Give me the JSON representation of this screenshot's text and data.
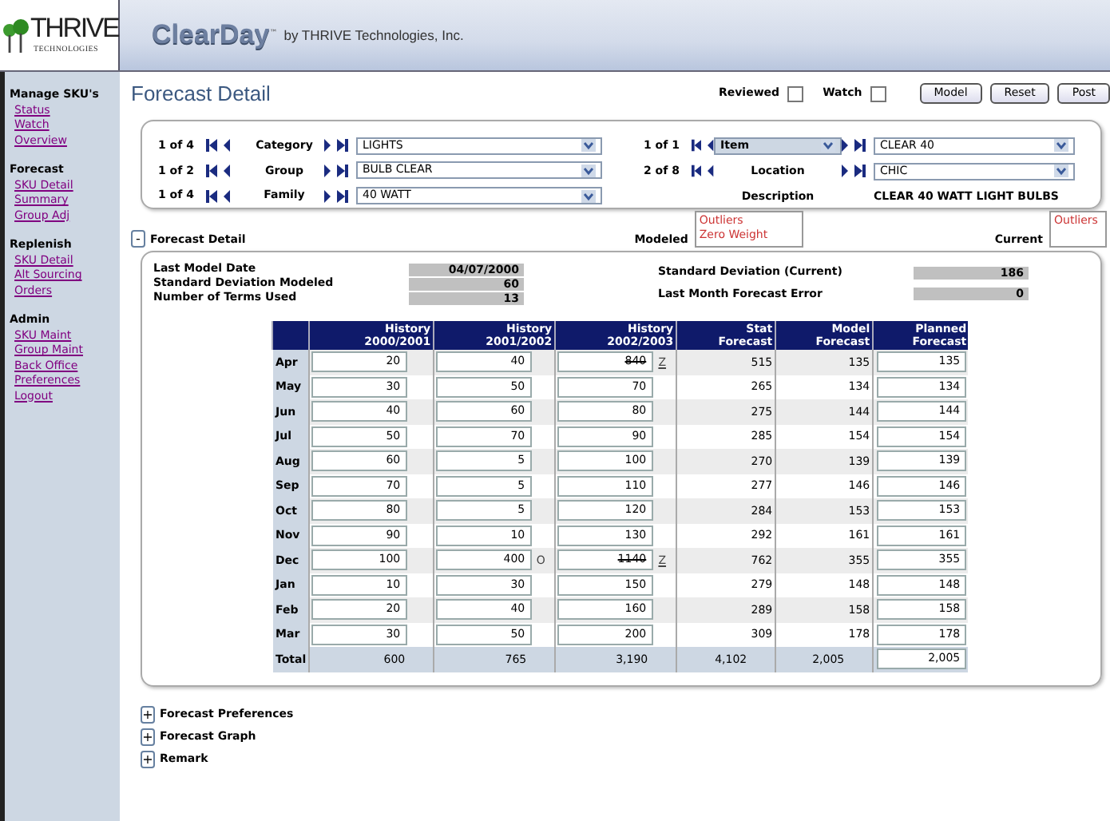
{
  "header": {
    "logo": "THRIVE",
    "logo_sub": "TECHNOLOGIES",
    "product": "ClearDay",
    "trademark": "™",
    "byline": "by THRIVE Technologies, Inc."
  },
  "sidebar": [
    {
      "title": "Manage SKU's",
      "links": [
        "Status",
        "Watch",
        "Overview"
      ]
    },
    {
      "title": "Forecast",
      "links": [
        "SKU Detail",
        "Summary",
        "Group Adj"
      ]
    },
    {
      "title": "Replenish",
      "links": [
        "SKU Detail",
        "Alt Sourcing",
        "Orders"
      ]
    },
    {
      "title": "Admin",
      "links": [
        "SKU Maint",
        "Group Maint",
        "Back Office",
        "Preferences",
        "Logout"
      ]
    }
  ],
  "title": "Forecast Detail",
  "flags": [
    {
      "label": "Reviewed",
      "checked": false
    },
    {
      "label": "Watch",
      "checked": false
    }
  ],
  "buttons": [
    "Model",
    "Reset",
    "Post"
  ],
  "selectors_left": [
    {
      "position": "1 of 4",
      "label": "Category",
      "value": "LIGHTS"
    },
    {
      "position": "1 of 2",
      "label": "Group",
      "value": "BULB CLEAR"
    },
    {
      "position": "1 of 4",
      "label": "Family",
      "value": "40 WATT"
    }
  ],
  "selectors_right": [
    {
      "position": "1 of 1",
      "label": "Item",
      "kind": "dropdown",
      "value": "CLEAR 40"
    },
    {
      "position": "2 of 8",
      "label": "Location",
      "kind": "text",
      "value": "CHIC"
    }
  ],
  "description": {
    "label": "Description",
    "value": "CLEAR 40 WATT LIGHT BULBS"
  },
  "detail_section": {
    "toggle": "-",
    "title": "Forecast Detail"
  },
  "modeled": {
    "label": "Modeled",
    "items": [
      "Outliers",
      "Zero Weight"
    ]
  },
  "current": {
    "label": "Current",
    "items": [
      "Outliers"
    ]
  },
  "stats_left": [
    {
      "label": "Last Model Date",
      "value": "04/07/2000"
    },
    {
      "label": "Standard Deviation Modeled",
      "value": "60"
    },
    {
      "label": "Number of Terms Used",
      "value": "13"
    }
  ],
  "stats_right": [
    {
      "label": "Standard Deviation (Current)",
      "value": "186"
    },
    {
      "label": "Last Month Forecast Error",
      "value": "0"
    }
  ],
  "table": {
    "columns": [
      [
        "History",
        "2000/2001"
      ],
      [
        "History",
        "2001/2002"
      ],
      [
        "History",
        "2002/2003"
      ],
      [
        "Stat",
        "Forecast"
      ],
      [
        "Model",
        "Forecast"
      ],
      [
        "Planned",
        "Forecast"
      ]
    ],
    "rows": [
      {
        "month": "Apr",
        "history": [
          {
            "value": "20"
          },
          {
            "value": "40"
          },
          {
            "value": "840",
            "struck": true,
            "marker": "Z",
            "marker_link": true
          }
        ],
        "stat": "515",
        "model": "135",
        "planned": "135"
      },
      {
        "month": "May",
        "history": [
          {
            "value": "30"
          },
          {
            "value": "50"
          },
          {
            "value": "70"
          }
        ],
        "stat": "265",
        "model": "134",
        "planned": "134"
      },
      {
        "month": "Jun",
        "history": [
          {
            "value": "40"
          },
          {
            "value": "60"
          },
          {
            "value": "80"
          }
        ],
        "stat": "275",
        "model": "144",
        "planned": "144"
      },
      {
        "month": "Jul",
        "history": [
          {
            "value": "50"
          },
          {
            "value": "70"
          },
          {
            "value": "90"
          }
        ],
        "stat": "285",
        "model": "154",
        "planned": "154"
      },
      {
        "month": "Aug",
        "history": [
          {
            "value": "60"
          },
          {
            "value": "5"
          },
          {
            "value": "100"
          }
        ],
        "stat": "270",
        "model": "139",
        "planned": "139"
      },
      {
        "month": "Sep",
        "history": [
          {
            "value": "70"
          },
          {
            "value": "5"
          },
          {
            "value": "110"
          }
        ],
        "stat": "277",
        "model": "146",
        "planned": "146"
      },
      {
        "month": "Oct",
        "history": [
          {
            "value": "80"
          },
          {
            "value": "5"
          },
          {
            "value": "120"
          }
        ],
        "stat": "284",
        "model": "153",
        "planned": "153"
      },
      {
        "month": "Nov",
        "history": [
          {
            "value": "90"
          },
          {
            "value": "10"
          },
          {
            "value": "130"
          }
        ],
        "stat": "292",
        "model": "161",
        "planned": "161"
      },
      {
        "month": "Dec",
        "history": [
          {
            "value": "100"
          },
          {
            "value": "400",
            "marker": "O",
            "marker_link": false
          },
          {
            "value": "1140",
            "struck": true,
            "marker": "Z",
            "marker_link": true
          }
        ],
        "stat": "762",
        "model": "355",
        "planned": "355"
      },
      {
        "month": "Jan",
        "history": [
          {
            "value": "10"
          },
          {
            "value": "30"
          },
          {
            "value": "150"
          }
        ],
        "stat": "279",
        "model": "148",
        "planned": "148"
      },
      {
        "month": "Feb",
        "history": [
          {
            "value": "20"
          },
          {
            "value": "40"
          },
          {
            "value": "160"
          }
        ],
        "stat": "289",
        "model": "158",
        "planned": "158"
      },
      {
        "month": "Mar",
        "history": [
          {
            "value": "30"
          },
          {
            "value": "50"
          },
          {
            "value": "200"
          }
        ],
        "stat": "309",
        "model": "178",
        "planned": "178"
      }
    ],
    "total": {
      "label": "Total",
      "values": [
        "600",
        "765",
        "3,190",
        "4,102",
        "2,005"
      ],
      "planned": "2,005"
    }
  },
  "collapsed_sections": [
    {
      "toggle": "+",
      "title": "Forecast Preferences"
    },
    {
      "toggle": "+",
      "title": "Forecast Graph"
    },
    {
      "toggle": "+",
      "title": "Remark"
    }
  ]
}
